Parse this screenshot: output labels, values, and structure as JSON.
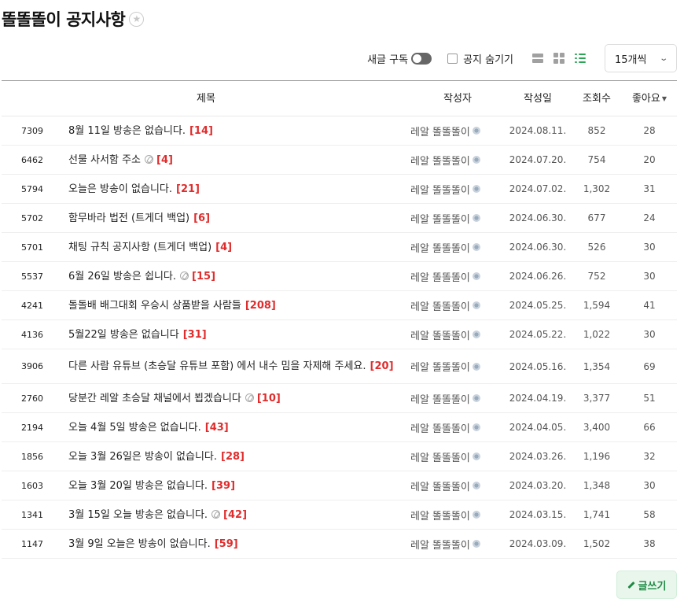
{
  "header": {
    "title": "똘똘똘이 공지사항"
  },
  "toolbar": {
    "new_post_label": "새글 구독",
    "hide_notice_label": "공지 숨기기",
    "per_page_value": "15개씩",
    "active_view": "detail-list",
    "accent_color": "#2aa655"
  },
  "table": {
    "headers": {
      "title": "제목",
      "author": "작성자",
      "date": "작성일",
      "views": "조회수",
      "likes": "좋아요"
    },
    "rows": [
      {
        "num": "7309",
        "title": "8월 11일 방송은 없습니다.",
        "attach": false,
        "comments": "[14]",
        "author": "레알 똘똘똘이",
        "date": "2024.08.11.",
        "views": "852",
        "likes": "28"
      },
      {
        "num": "6462",
        "title": "선물 사서함 주소",
        "attach": true,
        "comments": "[4]",
        "author": "레알 똘똘똘이",
        "date": "2024.07.20.",
        "views": "754",
        "likes": "20"
      },
      {
        "num": "5794",
        "title": "오늘은 방송이 없습니다.",
        "attach": false,
        "comments": "[21]",
        "author": "레알 똘똘똘이",
        "date": "2024.07.02.",
        "views": "1,302",
        "likes": "31"
      },
      {
        "num": "5702",
        "title": "함무바라 법전 (트게더 백업)",
        "attach": false,
        "comments": "[6]",
        "author": "레알 똘똘똘이",
        "date": "2024.06.30.",
        "views": "677",
        "likes": "24"
      },
      {
        "num": "5701",
        "title": "채팅 규칙 공지사항 (트게더 백업)",
        "attach": false,
        "comments": "[4]",
        "author": "레알 똘똘똘이",
        "date": "2024.06.30.",
        "views": "526",
        "likes": "30"
      },
      {
        "num": "5537",
        "title": "6월 26일 방송은 쉽니다.",
        "attach": true,
        "comments": "[15]",
        "author": "레알 똘똘똘이",
        "date": "2024.06.26.",
        "views": "752",
        "likes": "30"
      },
      {
        "num": "4241",
        "title": "돌돌배 배그대회 우승시 상품받을 사람들",
        "attach": false,
        "comments": "[208]",
        "author": "레알 똘똘똘이",
        "date": "2024.05.25.",
        "views": "1,594",
        "likes": "41"
      },
      {
        "num": "4136",
        "title": "5월22일 방송은 없습니다",
        "attach": false,
        "comments": "[31]",
        "author": "레알 똘똘똘이",
        "date": "2024.05.22.",
        "views": "1,022",
        "likes": "30"
      },
      {
        "num": "3906",
        "title": "다른 사람 유튜브 (초승달 유튜브 포함) 에서 내수 밈을 자제해 주세요.",
        "attach": false,
        "comments": "[20]",
        "author": "레알 똘똘똘이",
        "date": "2024.05.16.",
        "views": "1,354",
        "likes": "69"
      },
      {
        "num": "2760",
        "title": "당분간 레알 초승달 채널에서 뵙겠습니다",
        "attach": true,
        "comments": "[10]",
        "author": "레알 똘똘똘이",
        "date": "2024.04.19.",
        "views": "3,377",
        "likes": "51"
      },
      {
        "num": "2194",
        "title": "오늘 4월 5일 방송은 없습니다.",
        "attach": false,
        "comments": "[43]",
        "author": "레알 똘똘똘이",
        "date": "2024.04.05.",
        "views": "3,400",
        "likes": "66"
      },
      {
        "num": "1856",
        "title": "오늘 3월 26일은 방송이 없습니다.",
        "attach": false,
        "comments": "[28]",
        "author": "레알 똘똘똘이",
        "date": "2024.03.26.",
        "views": "1,196",
        "likes": "32"
      },
      {
        "num": "1603",
        "title": "오늘 3월 20일 방송은 없습니다.",
        "attach": false,
        "comments": "[39]",
        "author": "레알 똘똘똘이",
        "date": "2024.03.20.",
        "views": "1,348",
        "likes": "30"
      },
      {
        "num": "1341",
        "title": "3월 15일 오늘 방송은 없습니다.",
        "attach": true,
        "comments": "[42]",
        "author": "레알 똘똘똘이",
        "date": "2024.03.15.",
        "views": "1,741",
        "likes": "58"
      },
      {
        "num": "1147",
        "title": "3월 9일 오늘은 방송이 없습니다.",
        "attach": false,
        "comments": "[59]",
        "author": "레알 똘똘똘이",
        "date": "2024.03.09.",
        "views": "1,502",
        "likes": "38"
      }
    ]
  },
  "footer": {
    "write_label": "글쓰기"
  }
}
